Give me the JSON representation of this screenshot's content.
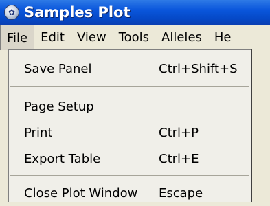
{
  "window": {
    "title": "Samples Plot",
    "icon": "app-globe-icon"
  },
  "menubar": {
    "items": [
      "File",
      "Edit",
      "View",
      "Tools",
      "Alleles",
      "He"
    ],
    "open_index": 0
  },
  "file_menu": {
    "items": [
      {
        "label": "Save Panel",
        "shortcut": "Ctrl+Shift+S"
      },
      {
        "label": "Page Setup",
        "shortcut": ""
      },
      {
        "label": "Print",
        "shortcut": "Ctrl+P"
      },
      {
        "label": "Export Table",
        "shortcut": "Ctrl+E"
      },
      {
        "label": "Close Plot Window",
        "shortcut": "Escape"
      }
    ]
  }
}
